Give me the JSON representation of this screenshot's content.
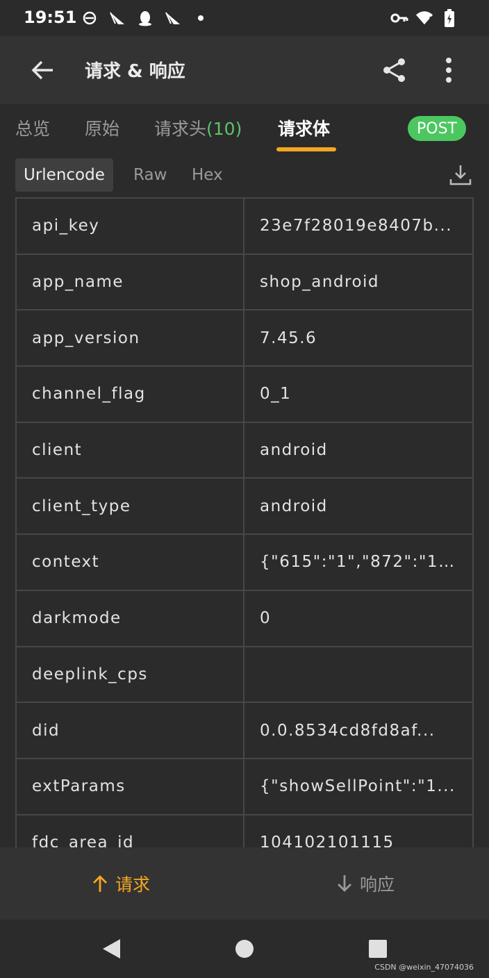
{
  "status_bar": {
    "time": "19:51",
    "left_icons": [
      "notification-app-icon",
      "airplane-app-icon",
      "qq-penguin-icon",
      "airplane-app-icon",
      "dot-icon"
    ],
    "right_icons": [
      "vpn-key-icon",
      "wifi-icon",
      "battery-charging-icon"
    ]
  },
  "app_bar": {
    "title": "请求 & 响应",
    "back_icon": "arrow-left-icon",
    "share_icon": "share-icon",
    "more_icon": "more-vert-icon"
  },
  "tabs": {
    "items": [
      {
        "label": "总览"
      },
      {
        "label": "原始"
      },
      {
        "label": "请求头",
        "count": "(10)"
      },
      {
        "label": "请求体"
      }
    ],
    "active_index": 3,
    "method_badge": "POST"
  },
  "body_tabs": {
    "items": [
      {
        "label": "Urlencode"
      },
      {
        "label": "Raw"
      },
      {
        "label": "Hex"
      }
    ],
    "active_index": 0,
    "download_icon": "download-icon"
  },
  "params": [
    {
      "key": "api_key",
      "value": "23e7f28019e8407b..."
    },
    {
      "key": "app_name",
      "value": "shop_android"
    },
    {
      "key": "app_version",
      "value": "7.45.6"
    },
    {
      "key": "channel_flag",
      "value": "0_1"
    },
    {
      "key": "client",
      "value": "android"
    },
    {
      "key": "client_type",
      "value": "android"
    },
    {
      "key": "context",
      "value": "{\"615\":\"1\",\"872\":\"1\"}"
    },
    {
      "key": "darkmode",
      "value": "0"
    },
    {
      "key": "deeplink_cps",
      "value": ""
    },
    {
      "key": "did",
      "value": "0.0.8534cd8fd8af..."
    },
    {
      "key": "extParams",
      "value": "{\"showSellPoint\":\"1..."
    },
    {
      "key": "fdc_area_id",
      "value": "104102101115"
    }
  ],
  "bottom_nav": {
    "request": "请求",
    "response": "响应"
  },
  "system_nav": {
    "back": "back-triangle-icon",
    "home": "home-circle-icon",
    "recents": "recents-square-icon"
  },
  "watermark": "CSDN @weixin_47074036",
  "colors": {
    "accent": "#f5a623",
    "post_badge": "#4cc760",
    "count_green": "#5cc36a",
    "background": "#2b2b2b",
    "app_bar": "#333333"
  }
}
